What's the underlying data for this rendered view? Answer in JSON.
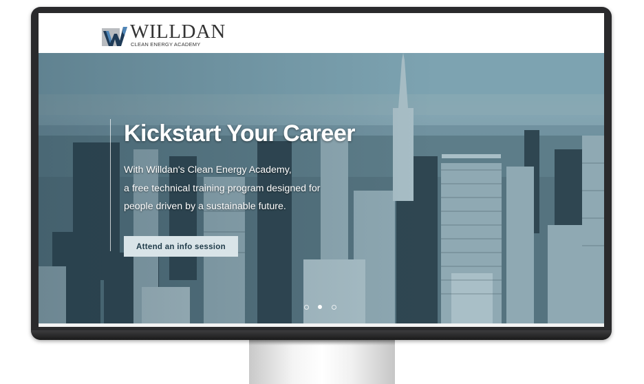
{
  "header": {
    "logo": {
      "name": "WILLDAN",
      "subtitle": "CLEAN ENERGY ACADEMY",
      "icon": "willdan-w-logo",
      "colors": {
        "mark_dark": "#1f3b57",
        "mark_light": "#4f86b8",
        "mark_bg": "#b9bcc0"
      }
    }
  },
  "hero": {
    "title": "Kickstart Your Career",
    "body_lines": [
      "With Willdan's Clean Energy Academy,",
      "a free technical training program designed for",
      "people driven by a sustainable future."
    ],
    "cta_label": "Attend an info session",
    "carousel": {
      "slide_count": 3,
      "active_index": 1
    },
    "background": "city-skyline-photo"
  },
  "colors": {
    "hero_tint": "#6f97a6",
    "cta_bg": "#d9e4e8",
    "cta_text": "#1e3a48",
    "monitor_frame": "#2a2a2c"
  }
}
